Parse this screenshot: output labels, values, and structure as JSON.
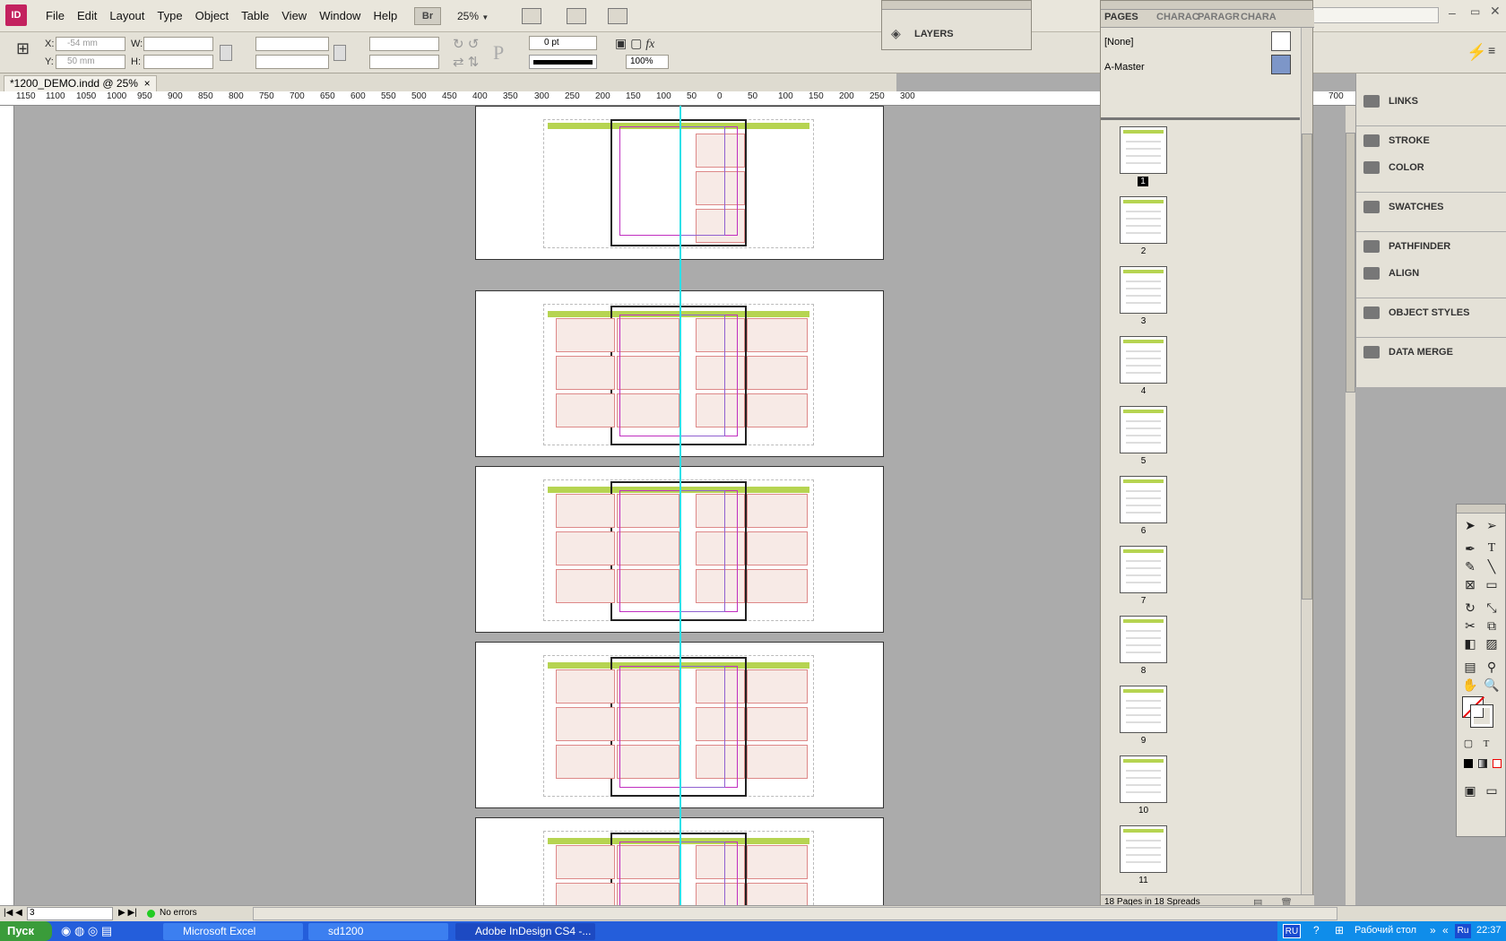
{
  "app": {
    "logo": "ID",
    "menu": [
      "File",
      "Edit",
      "Layout",
      "Type",
      "Object",
      "Table",
      "View",
      "Window",
      "Help"
    ],
    "bridge_label": "Br",
    "zoom": "25%"
  },
  "control": {
    "x_label": "X:",
    "y_label": "Y:",
    "w_label": "W:",
    "h_label": "H:",
    "x_value": "-54 mm",
    "y_value": "50 mm",
    "stroke_weight": "0 pt",
    "opacity": "100%"
  },
  "document": {
    "tab_title": "*1200_DEMO.indd @ 25%",
    "close": "×"
  },
  "ruler_labels": [
    "1150",
    "1100",
    "1050",
    "1000",
    "950",
    "900",
    "850",
    "800",
    "750",
    "700",
    "650",
    "600",
    "550",
    "500",
    "450",
    "400",
    "350",
    "300",
    "250",
    "200",
    "150",
    "100",
    "50",
    "0",
    "50",
    "100",
    "150",
    "200",
    "250",
    "300",
    "700"
  ],
  "layers": {
    "title": "LAYERS"
  },
  "pages_panel": {
    "tabs": [
      "PAGES",
      "CHARAC",
      "PARAGR",
      "CHARA"
    ],
    "masters": [
      "[None]",
      "A-Master"
    ],
    "thumbs": [
      "1",
      "2",
      "3",
      "4",
      "5",
      "6",
      "7",
      "8",
      "9",
      "10",
      "11"
    ],
    "footer": "18 Pages in 18 Spreads"
  },
  "right_panels": [
    "LINKS",
    "STROKE",
    "COLOR",
    "SWATCHES",
    "PATHFINDER",
    "ALIGN",
    "OBJECT STYLES",
    "DATA MERGE"
  ],
  "status": {
    "page": "3",
    "errors": "No errors"
  },
  "taskbar": {
    "start": "Пуск",
    "tasks": [
      "Microsoft Excel",
      "sd1200",
      "Adobe InDesign CS4 -..."
    ],
    "lang1": "RU",
    "lang2": "Ru",
    "desktop": "Рабочий стол",
    "time": "22:37"
  },
  "colors": {
    "accent": "#c3225f",
    "guide": "#2ee0e8",
    "magenta": "#c02fc0",
    "taskbar": "#245edb"
  }
}
